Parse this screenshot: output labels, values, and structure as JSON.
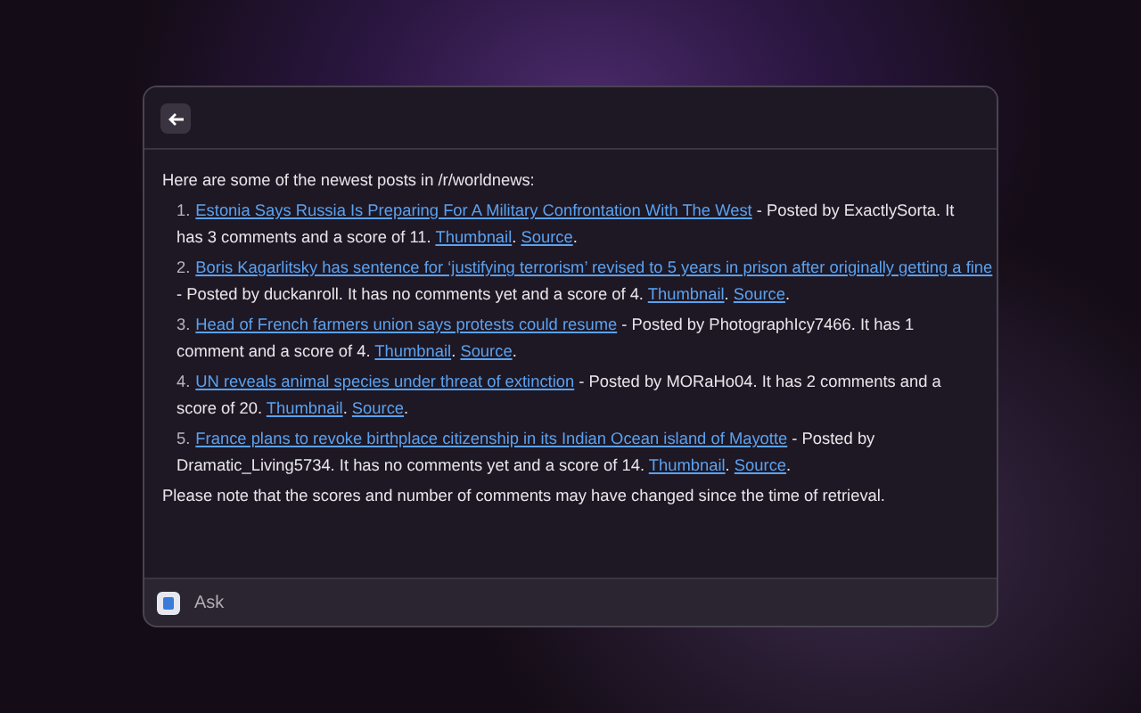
{
  "intro": "Here are some of the newest posts in /r/worldnews:",
  "posts": [
    {
      "number": "1.",
      "parts": [
        {
          "kind": "link",
          "text": "Estonia Says Russia Is Preparing For A Military Confrontation With The West"
        },
        {
          "kind": "text",
          "text": " - Posted by ExactlySorta. It has 3 comments and a score of 11. "
        },
        {
          "kind": "link",
          "text": "Thumbnail"
        },
        {
          "kind": "text",
          "text": ". "
        },
        {
          "kind": "link",
          "text": "Source"
        },
        {
          "kind": "text",
          "text": "."
        }
      ]
    },
    {
      "number": "2.",
      "parts": [
        {
          "kind": "link",
          "text": "Boris Kagarlitsky has sentence for ‘justifying terrorism’ revised to 5 years in prison after originally getting a fine"
        },
        {
          "kind": "text",
          "text": " - Posted by duckanroll. It has no comments yet and a score of 4. "
        },
        {
          "kind": "link",
          "text": "Thumbnail"
        },
        {
          "kind": "text",
          "text": ". "
        },
        {
          "kind": "link",
          "text": "Source"
        },
        {
          "kind": "text",
          "text": "."
        }
      ]
    },
    {
      "number": "3.",
      "parts": [
        {
          "kind": "link",
          "text": "Head of French farmers union says protests could resume"
        },
        {
          "kind": "text",
          "text": " - Posted by PhotographIcy7466. It has 1 comment and a score of 4. "
        },
        {
          "kind": "link",
          "text": "Thumbnail"
        },
        {
          "kind": "text",
          "text": ". "
        },
        {
          "kind": "link",
          "text": "Source"
        },
        {
          "kind": "text",
          "text": "."
        }
      ]
    },
    {
      "number": "4.",
      "parts": [
        {
          "kind": "link",
          "text": "UN reveals animal species under threat of extinction"
        },
        {
          "kind": "text",
          "text": " - Posted by MORaHo04. It has 2 comments and a score of 20. "
        },
        {
          "kind": "link",
          "text": "Thumbnail"
        },
        {
          "kind": "text",
          "text": ". "
        },
        {
          "kind": "link",
          "text": "Source"
        },
        {
          "kind": "text",
          "text": "."
        }
      ]
    },
    {
      "number": "5.",
      "parts": [
        {
          "kind": "link",
          "text": "France plans to revoke birthplace citizenship in its Indian Ocean island of Mayotte"
        },
        {
          "kind": "text",
          "text": " - Posted by Dramatic_Living5734. It has no comments yet and a score of 14. "
        },
        {
          "kind": "link",
          "text": "Thumbnail"
        },
        {
          "kind": "text",
          "text": ". "
        },
        {
          "kind": "link",
          "text": "Source"
        },
        {
          "kind": "text",
          "text": "."
        }
      ]
    }
  ],
  "note": "Please note that the scores and number of comments may have changed since the time of retrieval.",
  "ask": {
    "placeholder": "Ask"
  }
}
